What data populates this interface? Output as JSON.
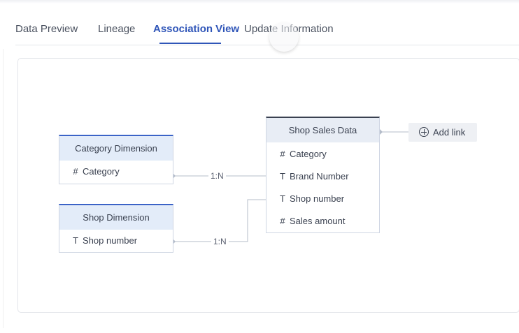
{
  "tabs": [
    {
      "label": "Data Preview",
      "active": false
    },
    {
      "label": "Lineage",
      "active": false
    },
    {
      "label": "Association View",
      "active": true
    },
    {
      "label": "Update Information",
      "active": false
    }
  ],
  "graph": {
    "main_table": {
      "title": "Shop Sales Data",
      "fields": [
        {
          "type_icon": "hash-icon",
          "glyph": "#",
          "name": "Category"
        },
        {
          "type_icon": "text-type-icon",
          "glyph": "T",
          "name": "Brand Number"
        },
        {
          "type_icon": "text-type-icon",
          "glyph": "T",
          "name": "Shop number"
        },
        {
          "type_icon": "hash-icon",
          "glyph": "#",
          "name": "Sales amount"
        }
      ]
    },
    "dimensions": [
      {
        "title": "Category Dimension",
        "fields": [
          {
            "type_icon": "hash-icon",
            "glyph": "#",
            "name": "Category"
          }
        ],
        "relation": "1:N"
      },
      {
        "title": "Shop Dimension",
        "fields": [
          {
            "type_icon": "text-type-icon",
            "glyph": "T",
            "name": "Shop number"
          }
        ],
        "relation": "1:N"
      }
    ],
    "add_link_label": "Add link"
  },
  "colors": {
    "accent": "#2f55b8",
    "header_bg": "#e3ecf9",
    "link_line": "#b4bcc9"
  }
}
